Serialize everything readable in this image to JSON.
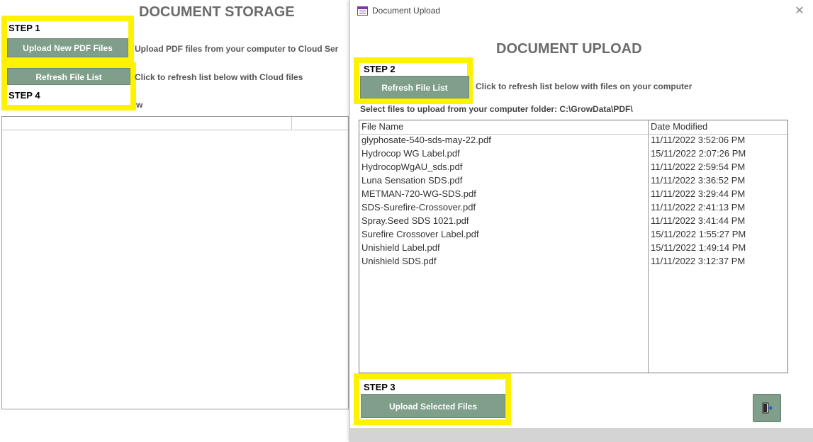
{
  "background_form": {
    "title": "DOCUMENT STORAGE",
    "step1": {
      "label": "STEP 1",
      "button": "Upload New PDF Files",
      "caption": "Upload PDF files from your computer to Cloud Ser"
    },
    "step4": {
      "label": "STEP 4",
      "button": "Refresh File List",
      "caption": "Click to refresh list below with Cloud files"
    },
    "partial_text": "w"
  },
  "dialog": {
    "window_title": "Document Upload",
    "close_icon": "close-icon",
    "title": "DOCUMENT UPLOAD",
    "step2": {
      "label": "STEP 2",
      "button": "Refresh File List",
      "caption": "Click to refresh list below with files on your computer"
    },
    "folder_label": "Select files to upload from your computer folder:  C:\\GrowData\\PDF\\",
    "file_list": {
      "columns": [
        "File Name",
        "Date Modified"
      ],
      "rows": [
        {
          "name": "glyphosate-540-sds-may-22.pdf",
          "date": "11/11/2022 3:52:06 PM"
        },
        {
          "name": "Hydrocop WG Label.pdf",
          "date": "15/11/2022 2:07:26 PM"
        },
        {
          "name": "HydrocopWgAU_sds.pdf",
          "date": "11/11/2022 2:59:54 PM"
        },
        {
          "name": "Luna Sensation SDS.pdf",
          "date": "11/11/2022 3:36:52 PM"
        },
        {
          "name": "METMAN-720-WG-SDS.pdf",
          "date": "11/11/2022 3:29:44 PM"
        },
        {
          "name": "SDS-Surefire-Crossover.pdf",
          "date": "11/11/2022 2:41:13 PM"
        },
        {
          "name": "Spray.Seed SDS 1021.pdf",
          "date": "11/11/2022 3:41:44 PM"
        },
        {
          "name": "Surefire Crossover Label.pdf",
          "date": "15/11/2022 1:55:27 PM"
        },
        {
          "name": "Unishield Label.pdf",
          "date": "15/11/2022 1:49:14 PM"
        },
        {
          "name": "Unishield SDS.pdf",
          "date": "11/11/2022 3:12:37 PM"
        }
      ]
    },
    "step3": {
      "label": "STEP 3",
      "button": "Upload Selected Files"
    },
    "exit_icon": "exit-door-icon"
  },
  "colors": {
    "highlight": "#fff200",
    "button": "#7f9f8a",
    "title_gray": "#6b6b6b"
  }
}
